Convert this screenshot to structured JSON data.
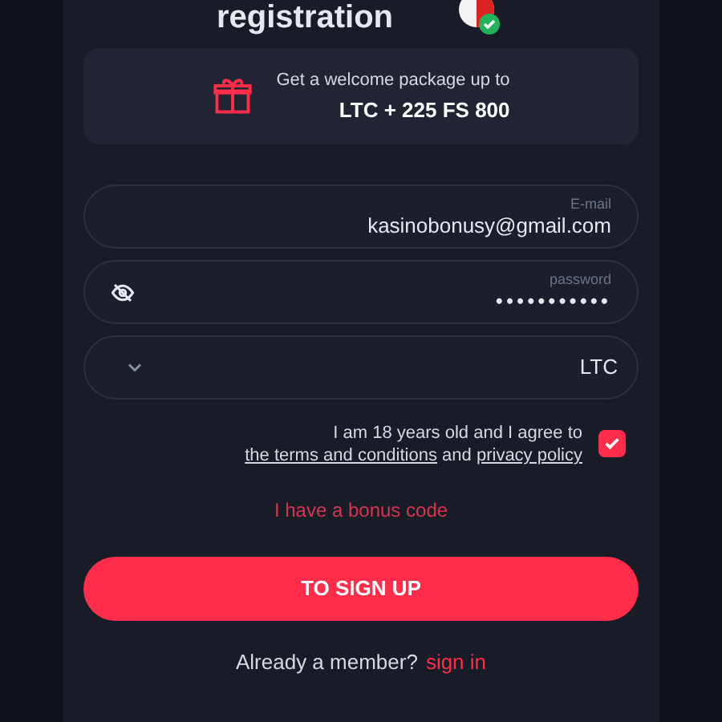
{
  "title": "registration",
  "promo": {
    "line1": "Get a welcome package up to",
    "line2": "LTC + 225 FS 800"
  },
  "fields": [
    {
      "kind": "text",
      "label": "E-mail",
      "value": "kasinobonusy@gmail.com"
    },
    {
      "kind": "password",
      "label": "password",
      "value": "•••••••••••"
    },
    {
      "kind": "select",
      "value": "LTC"
    }
  ],
  "agreement": {
    "checked": true,
    "text": "I am 18 years old and I agree to",
    "link1": "the terms and conditions",
    "middle": "and",
    "link2": "privacy policy"
  },
  "bonus_link": "I have a bonus code",
  "submit": "TO SIGN UP",
  "footer": {
    "text": "Already a member?",
    "link": "sign in"
  }
}
